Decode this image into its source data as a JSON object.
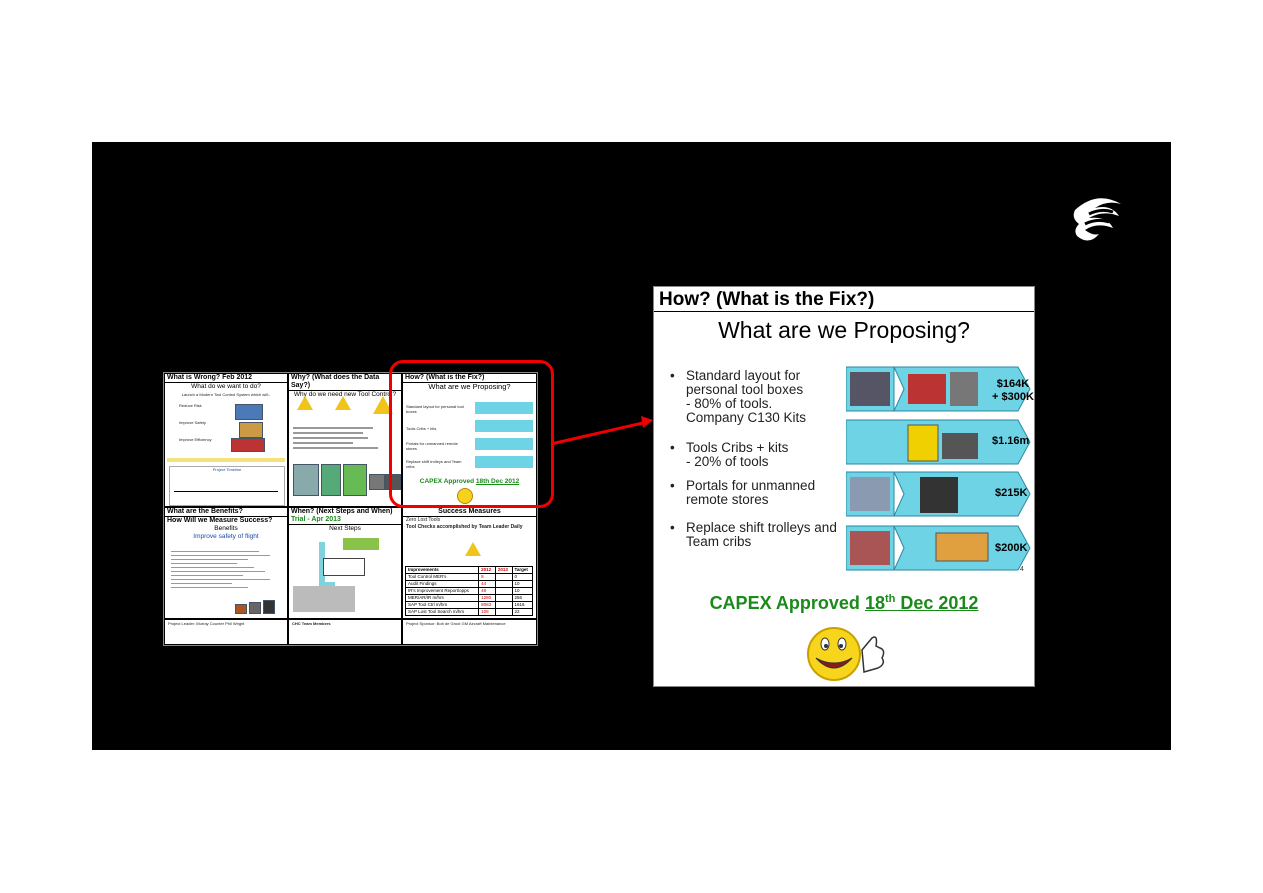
{
  "thumbnail": {
    "q1_title": "What is Wrong?  Feb 2012",
    "q1_sub": "What do we want to do?",
    "q1_text": "Launch a Modern Tool Control System which will:-",
    "q1_items": [
      "Reduce Risk",
      "Improve Safety",
      "Improve Efficiency"
    ],
    "q1_timeline": "Project Timeline",
    "q2_title": "Why? (What does the Data Say?)",
    "q2_sub": "Why do we need new Tool Control?",
    "q3_title": "How? (What is the Fix?)",
    "q3_sub": "What are we Proposing?",
    "q3_items": [
      "Standard layout for personal tool boxes",
      "Tools Cribs + kits",
      "Portals for unmanned remote stores",
      "Replace shift trolleys and Team cribs"
    ],
    "q3_capex": "CAPEX Approved",
    "q3_capex_date": "18th Dec 2012",
    "q4_title": "What are the Benefits?",
    "q4_title2": "How Will we Measure Success?",
    "q4_sub": "Benefits",
    "q4_sub2": "Improve safety of flight",
    "q5_title": "When? (Next Steps and When)",
    "q5_sub_green": "Trial - Apr 2013",
    "q5_sub": "Next Steps",
    "q6_title": "Success Measures",
    "q6_line1": "Zero Lost Tools",
    "q6_line2": "Tool Checks accomplished by Team Leader Daily",
    "q6_table_head": [
      "Improvements",
      "2012",
      "2013",
      "Target"
    ],
    "q6_table_rows": [
      [
        "Tool Control MER's",
        "8",
        "",
        "0"
      ],
      [
        "Audit Findings",
        "44",
        "",
        "10"
      ],
      [
        "IR's Improvement Report/opps",
        "49",
        "",
        "10"
      ],
      [
        "MER/AR/IR m/hrs",
        "1280",
        "",
        "256"
      ],
      [
        "SAP Tool Ctrl m/hrs",
        "8083",
        "",
        "1616"
      ],
      [
        "SAP Lost Tool Search m/hrs",
        "108",
        "",
        "22"
      ]
    ],
    "footer_left": "Project Leader:     Murray Counter        Phil Wright",
    "footer_mid": "CHC Team Members",
    "footer_right": "Project Sponsor:   Bob de Groot      GM Aircraft Maintenance"
  },
  "zoom": {
    "title": "How? (What is the Fix?)",
    "subtitle": "What are we Proposing?",
    "bullets": [
      "Standard layout for\npersonal tool boxes\n- 80% of tools.\nCompany C130 Kits",
      "Tools Cribs + kits\n- 20% of tools",
      "Portals for unmanned\nremote stores",
      "Replace shift trolleys and\nTeam cribs"
    ],
    "prices": [
      "$164K\n+ $300K",
      "$1.16m",
      "$215K",
      "$200K"
    ],
    "capex_label": "CAPEX Approved",
    "capex_date_pre": "18",
    "capex_date_sup": "th",
    "capex_date_post": " Dec 2012",
    "page_number": "4"
  },
  "colors": {
    "highlight": "#e00000",
    "approved": "#1a8a1a",
    "band": "#6fd3e6"
  }
}
